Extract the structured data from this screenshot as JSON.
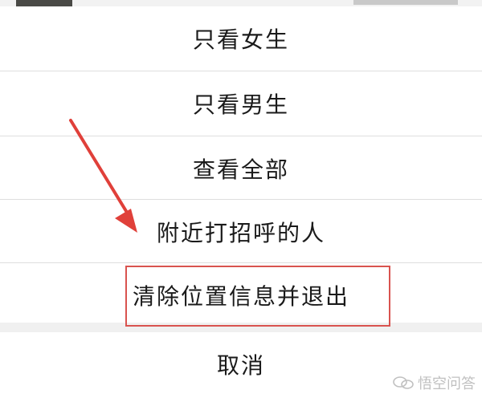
{
  "menu": {
    "items": [
      {
        "label": "只看女生"
      },
      {
        "label": "只看男生"
      },
      {
        "label": "查看全部"
      },
      {
        "label": "附近打招呼的人"
      },
      {
        "label": "清除位置信息并退出"
      }
    ],
    "cancel_label": "取消"
  },
  "annotation": {
    "highlight_color": "#d9534f",
    "arrow_color": "#e0403a"
  },
  "watermark": {
    "text": "悟空问答"
  }
}
